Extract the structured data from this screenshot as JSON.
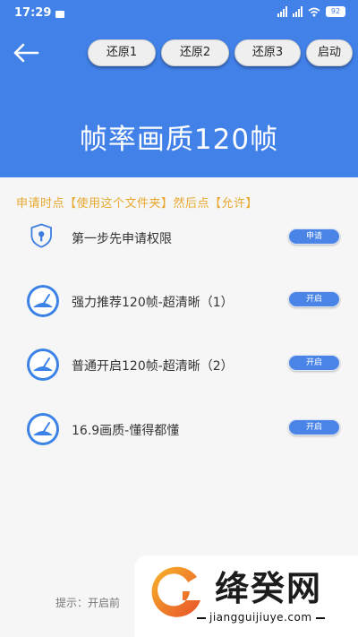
{
  "status_bar": {
    "time": "17:29",
    "battery": "92"
  },
  "top_buttons": [
    {
      "label": "还原1"
    },
    {
      "label": "还原2"
    },
    {
      "label": "还原3"
    },
    {
      "label": "启动"
    }
  ],
  "title": "帧率画质120帧",
  "notice": "申请时点【使用这个文件夹】然后点【允许】",
  "rows": [
    {
      "label": "第一步先申请权限",
      "button": "申请",
      "icon": "shield-icon"
    },
    {
      "label": "强力推荐120帧-超清晰（1）",
      "button": "开启",
      "icon": "speedometer-icon"
    },
    {
      "label": "普通开启120帧-超清晰（2）",
      "button": "开启",
      "icon": "speedometer-icon"
    },
    {
      "label": "16.9画质-懂得都懂",
      "button": "开启",
      "icon": "speedometer-icon"
    }
  ],
  "hint": "提示：开启前",
  "watermark": {
    "brand": "绛癸网",
    "url": "jiangguijiuye.com"
  },
  "colors": {
    "header": "#4181e8",
    "notice": "#e8a82f",
    "button": "#4a84e6"
  }
}
